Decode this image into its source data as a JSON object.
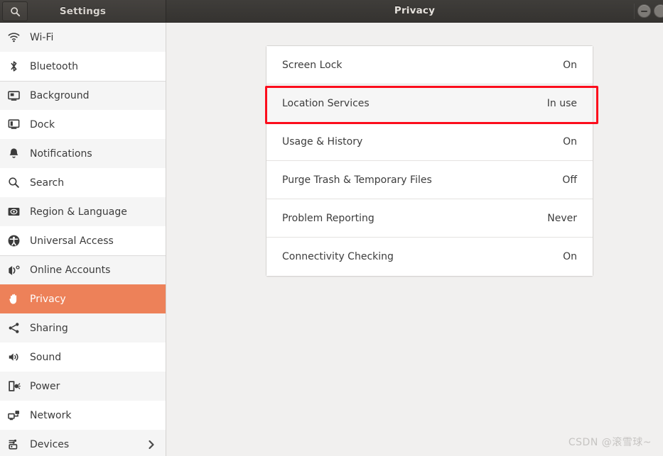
{
  "window": {
    "sidebar_title": "Settings",
    "title": "Privacy",
    "search_icon": "search-icon",
    "minimize_label": "minimize-button"
  },
  "sidebar": {
    "items": [
      {
        "label": "Wi-Fi",
        "icon": "wifi-icon",
        "selected": false,
        "chevron": false,
        "group_start": false
      },
      {
        "label": "Bluetooth",
        "icon": "bluetooth-icon",
        "selected": false,
        "chevron": false,
        "group_start": false
      },
      {
        "label": "Background",
        "icon": "background-icon",
        "selected": false,
        "chevron": false,
        "group_start": true
      },
      {
        "label": "Dock",
        "icon": "dock-icon",
        "selected": false,
        "chevron": false,
        "group_start": false
      },
      {
        "label": "Notifications",
        "icon": "bell-icon",
        "selected": false,
        "chevron": false,
        "group_start": false
      },
      {
        "label": "Search",
        "icon": "search-icon",
        "selected": false,
        "chevron": false,
        "group_start": false
      },
      {
        "label": "Region & Language",
        "icon": "region-language-icon",
        "selected": false,
        "chevron": false,
        "group_start": false
      },
      {
        "label": "Universal Access",
        "icon": "accessibility-icon",
        "selected": false,
        "chevron": false,
        "group_start": false
      },
      {
        "label": "Online Accounts",
        "icon": "online-accounts-icon",
        "selected": false,
        "chevron": false,
        "group_start": true
      },
      {
        "label": "Privacy",
        "icon": "hand-privacy-icon",
        "selected": true,
        "chevron": false,
        "group_start": false
      },
      {
        "label": "Sharing",
        "icon": "share-icon",
        "selected": false,
        "chevron": false,
        "group_start": false
      },
      {
        "label": "Sound",
        "icon": "speaker-icon",
        "selected": false,
        "chevron": false,
        "group_start": false
      },
      {
        "label": "Power",
        "icon": "power-battery-icon",
        "selected": false,
        "chevron": false,
        "group_start": false
      },
      {
        "label": "Network",
        "icon": "network-icon",
        "selected": false,
        "chevron": false,
        "group_start": false
      },
      {
        "label": "Devices",
        "icon": "devices-icon",
        "selected": false,
        "chevron": true,
        "group_start": false
      }
    ]
  },
  "main": {
    "rows": [
      {
        "label": "Screen Lock",
        "value": "On",
        "highlighted": false
      },
      {
        "label": "Location Services",
        "value": "In use",
        "highlighted": true
      },
      {
        "label": "Usage & History",
        "value": "On",
        "highlighted": false
      },
      {
        "label": "Purge Trash & Temporary Files",
        "value": "Off",
        "highlighted": false
      },
      {
        "label": "Problem Reporting",
        "value": "Never",
        "highlighted": false
      },
      {
        "label": "Connectivity Checking",
        "value": "On",
        "highlighted": false
      }
    ]
  },
  "annotation": {
    "highlight_color": "#fc0d1c",
    "target_row": "Location Services"
  },
  "watermark": {
    "text": "CSDN @滚雪球~"
  },
  "colors": {
    "accent": "#ed8159",
    "titlebar": "#3a3835",
    "panel_bg": "#ffffff",
    "main_bg": "#f1f0ef",
    "row_alt": "#f5f5f5"
  }
}
